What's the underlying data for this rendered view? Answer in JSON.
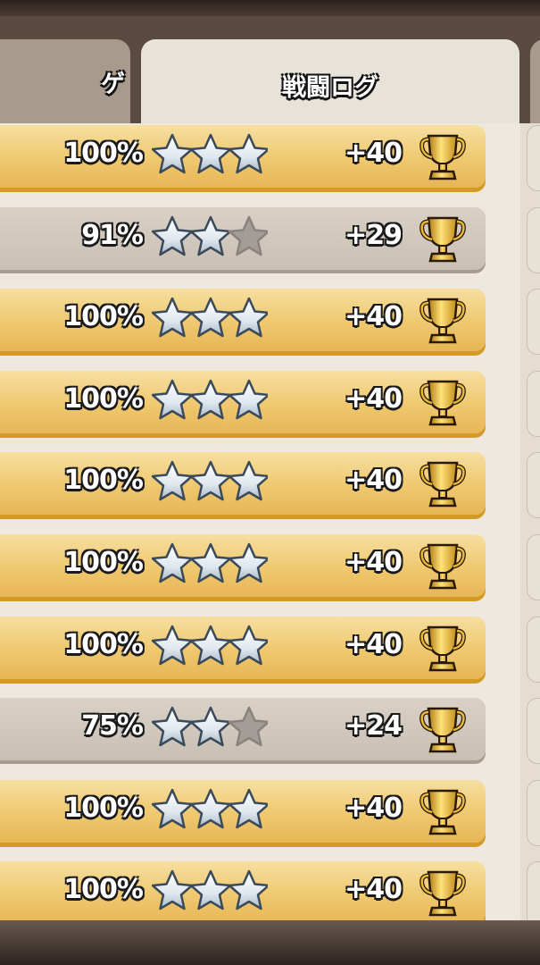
{
  "tabs": [
    {
      "label": "ゲ"
    },
    {
      "label": "戦闘ログ",
      "active": true
    }
  ],
  "battles": [
    {
      "percent": "100%",
      "stars": 3,
      "trophies": "+40",
      "style": "gold"
    },
    {
      "percent": "91%",
      "stars": 2,
      "trophies": "+29",
      "style": "gray"
    },
    {
      "percent": "100%",
      "stars": 3,
      "trophies": "+40",
      "style": "gold"
    },
    {
      "percent": "100%",
      "stars": 3,
      "trophies": "+40",
      "style": "gold"
    },
    {
      "percent": "100%",
      "stars": 3,
      "trophies": "+40",
      "style": "gold"
    },
    {
      "percent": "100%",
      "stars": 3,
      "trophies": "+40",
      "style": "gold"
    },
    {
      "percent": "100%",
      "stars": 3,
      "trophies": "+40",
      "style": "gold"
    },
    {
      "percent": "75%",
      "stars": 2,
      "trophies": "+24",
      "style": "gray"
    },
    {
      "percent": "100%",
      "stars": 3,
      "trophies": "+40",
      "style": "gold"
    },
    {
      "percent": "100%",
      "stars": 3,
      "trophies": "+40",
      "style": "gold"
    }
  ],
  "icons": {
    "star": "star-icon",
    "trophy": "trophy-icon"
  },
  "colors": {
    "gold_row": "#efc86f",
    "gray_row": "#c9bfb5",
    "star_filled": "#dfe7ee",
    "star_empty": "#a39d97"
  }
}
